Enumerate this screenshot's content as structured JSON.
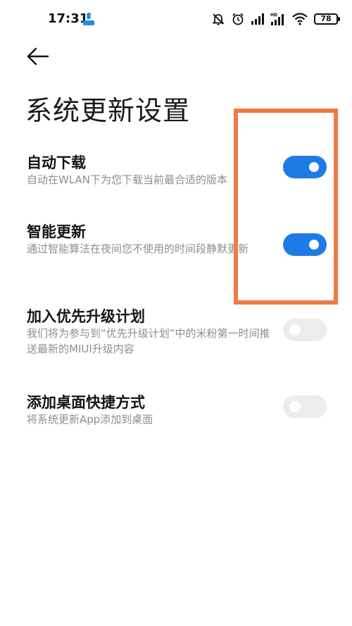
{
  "status_bar": {
    "time": "17:31",
    "battery": "78",
    "icons": [
      "app-notification-icon",
      "mute-icon",
      "alarm-icon",
      "signal-icon",
      "signal-hd-icon",
      "wifi-icon",
      "battery-icon"
    ]
  },
  "header": {
    "back_icon": "back-arrow-icon",
    "title": "系统更新设置"
  },
  "settings": [
    {
      "title": "自动下载",
      "desc": "自动在WLAN下为您下载当前最合适的版本",
      "enabled": true
    },
    {
      "title": "智能更新",
      "desc": "通过智能算法在夜间您不使用的时间段静默更新",
      "enabled": true
    },
    {
      "title": "加入优先升级计划",
      "desc": "我们将为参与到“优先升级计划”中的米粉第一时间推送最新的MIUI升级内容",
      "enabled": false
    },
    {
      "title": "添加桌面快捷方式",
      "desc": "将系统更新App添加到桌面",
      "enabled": false
    }
  ],
  "colors": {
    "toggle_on": "#1e7be6",
    "toggle_off": "#ececec",
    "highlight": "#f07a45",
    "desc_text": "#8e8e8e"
  }
}
